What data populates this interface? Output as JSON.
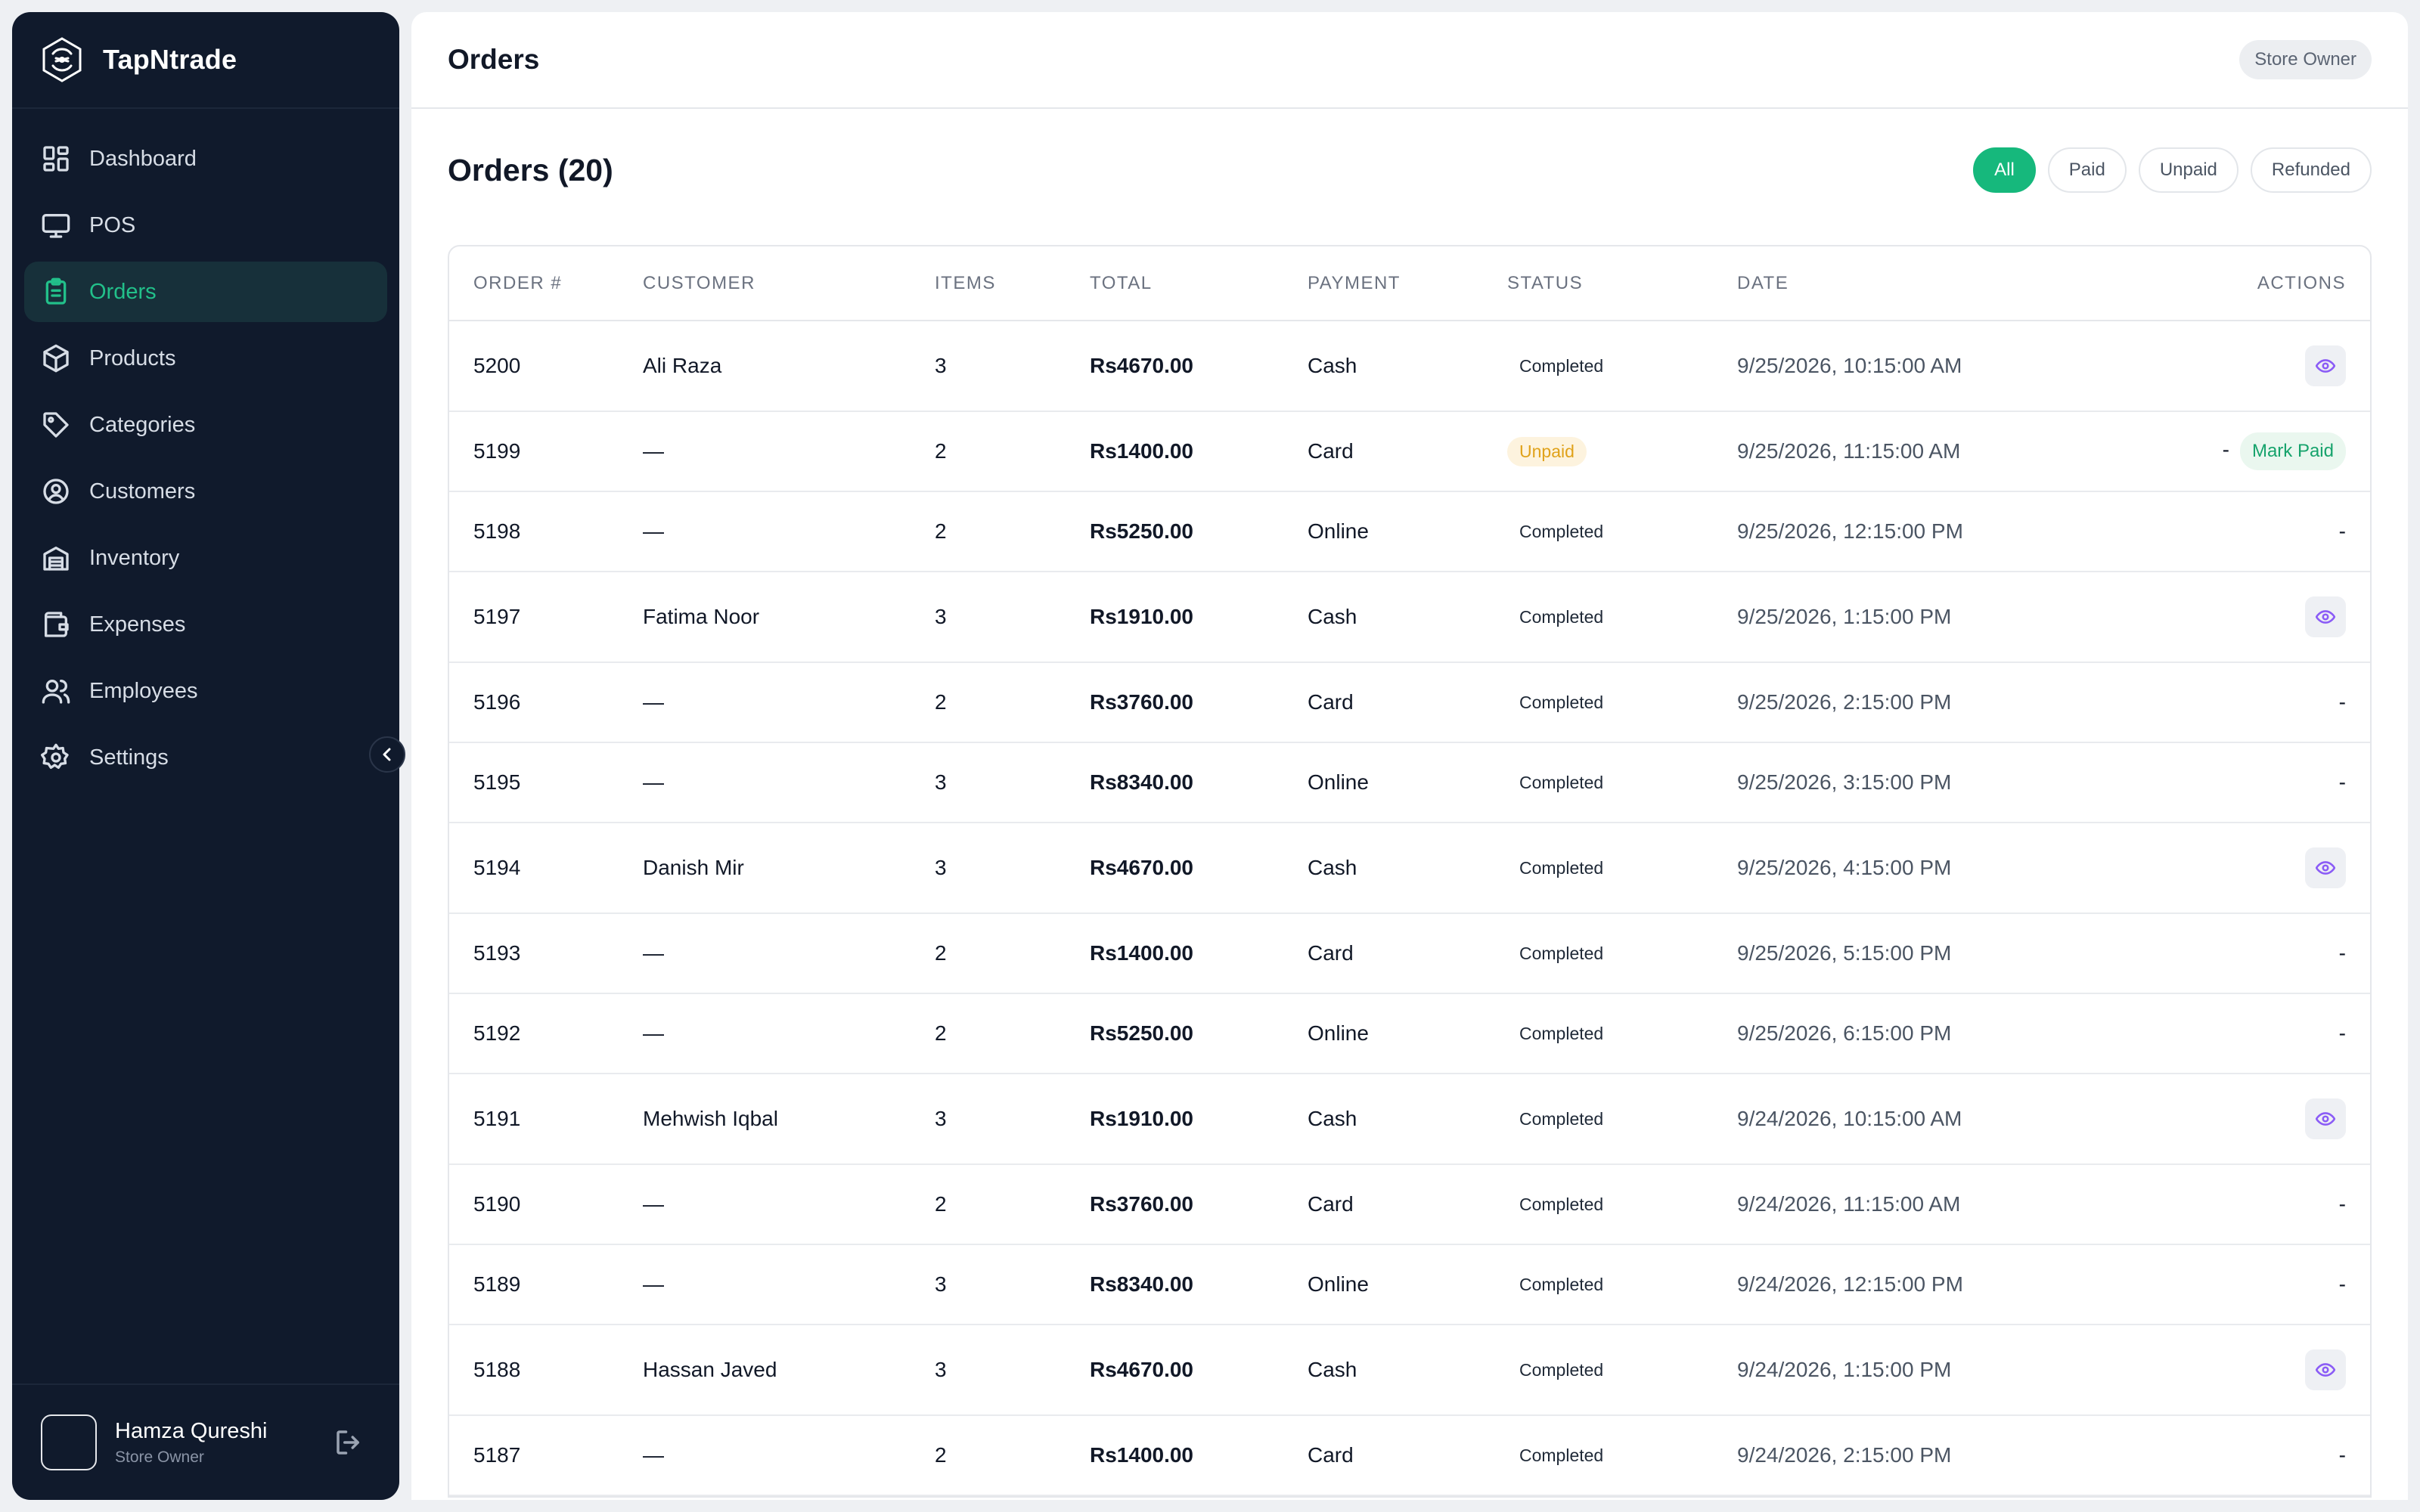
{
  "brand": {
    "name": "TapNtrade"
  },
  "sidebar": {
    "items": [
      {
        "label": "Dashboard",
        "icon": "dashboard-icon",
        "active": false
      },
      {
        "label": "POS",
        "icon": "monitor-icon",
        "active": false
      },
      {
        "label": "Orders",
        "icon": "clipboard-icon",
        "active": true
      },
      {
        "label": "Products",
        "icon": "box-icon",
        "active": false
      },
      {
        "label": "Categories",
        "icon": "tag-icon",
        "active": false
      },
      {
        "label": "Customers",
        "icon": "user-circle-icon",
        "active": false
      },
      {
        "label": "Inventory",
        "icon": "warehouse-icon",
        "active": false
      },
      {
        "label": "Expenses",
        "icon": "wallet-icon",
        "active": false
      },
      {
        "label": "Employees",
        "icon": "users-icon",
        "active": false
      },
      {
        "label": "Settings",
        "icon": "gear-icon",
        "active": false
      }
    ],
    "user": {
      "name": "Hamza Qureshi",
      "role": "Store Owner"
    }
  },
  "header": {
    "title": "Orders",
    "role_badge": "Store Owner"
  },
  "main": {
    "title": "Orders (20)",
    "filters": [
      {
        "label": "All",
        "active": true
      },
      {
        "label": "Paid",
        "active": false
      },
      {
        "label": "Unpaid",
        "active": false
      },
      {
        "label": "Refunded",
        "active": false
      }
    ],
    "table": {
      "columns": [
        "ORDER #",
        "CUSTOMER",
        "ITEMS",
        "TOTAL",
        "PAYMENT",
        "STATUS",
        "DATE",
        "ACTIONS"
      ],
      "mark_paid_label": "Mark Paid",
      "rows": [
        {
          "order": "5200",
          "customer": "Ali Raza",
          "items": "3",
          "total": "Rs4670.00",
          "payment": "Cash",
          "status": "Completed",
          "date": "9/25/2026, 10:15:00 AM",
          "action": "view"
        },
        {
          "order": "5199",
          "customer": "—",
          "items": "2",
          "total": "Rs1400.00",
          "payment": "Card",
          "status": "Unpaid",
          "date": "9/25/2026, 11:15:00 AM",
          "action": "mark-paid"
        },
        {
          "order": "5198",
          "customer": "—",
          "items": "2",
          "total": "Rs5250.00",
          "payment": "Online",
          "status": "Completed",
          "date": "9/25/2026, 12:15:00 PM",
          "action": "none"
        },
        {
          "order": "5197",
          "customer": "Fatima Noor",
          "items": "3",
          "total": "Rs1910.00",
          "payment": "Cash",
          "status": "Completed",
          "date": "9/25/2026, 1:15:00 PM",
          "action": "view"
        },
        {
          "order": "5196",
          "customer": "—",
          "items": "2",
          "total": "Rs3760.00",
          "payment": "Card",
          "status": "Completed",
          "date": "9/25/2026, 2:15:00 PM",
          "action": "none"
        },
        {
          "order": "5195",
          "customer": "—",
          "items": "3",
          "total": "Rs8340.00",
          "payment": "Online",
          "status": "Completed",
          "date": "9/25/2026, 3:15:00 PM",
          "action": "none"
        },
        {
          "order": "5194",
          "customer": "Danish Mir",
          "items": "3",
          "total": "Rs4670.00",
          "payment": "Cash",
          "status": "Completed",
          "date": "9/25/2026, 4:15:00 PM",
          "action": "view"
        },
        {
          "order": "5193",
          "customer": "—",
          "items": "2",
          "total": "Rs1400.00",
          "payment": "Card",
          "status": "Completed",
          "date": "9/25/2026, 5:15:00 PM",
          "action": "none"
        },
        {
          "order": "5192",
          "customer": "—",
          "items": "2",
          "total": "Rs5250.00",
          "payment": "Online",
          "status": "Completed",
          "date": "9/25/2026, 6:15:00 PM",
          "action": "none"
        },
        {
          "order": "5191",
          "customer": "Mehwish Iqbal",
          "items": "3",
          "total": "Rs1910.00",
          "payment": "Cash",
          "status": "Completed",
          "date": "9/24/2026, 10:15:00 AM",
          "action": "view"
        },
        {
          "order": "5190",
          "customer": "—",
          "items": "2",
          "total": "Rs3760.00",
          "payment": "Card",
          "status": "Completed",
          "date": "9/24/2026, 11:15:00 AM",
          "action": "none"
        },
        {
          "order": "5189",
          "customer": "—",
          "items": "3",
          "total": "Rs8340.00",
          "payment": "Online",
          "status": "Completed",
          "date": "9/24/2026, 12:15:00 PM",
          "action": "none"
        },
        {
          "order": "5188",
          "customer": "Hassan Javed",
          "items": "3",
          "total": "Rs4670.00",
          "payment": "Cash",
          "status": "Completed",
          "date": "9/24/2026, 1:15:00 PM",
          "action": "view"
        },
        {
          "order": "5187",
          "customer": "—",
          "items": "2",
          "total": "Rs1400.00",
          "payment": "Card",
          "status": "Completed",
          "date": "9/24/2026, 2:15:00 PM",
          "action": "none"
        }
      ]
    }
  },
  "colors": {
    "sidebar_bg": "#101a2c",
    "accent": "#16b87c",
    "unpaid": "#e0a21a",
    "view_icon": "#8b5cf6"
  }
}
